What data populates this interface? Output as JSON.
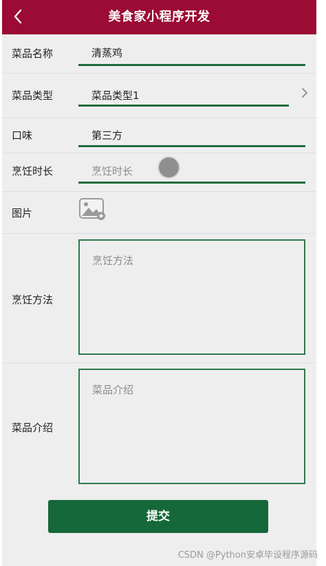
{
  "header": {
    "title": "美食家小程序开发",
    "back_icon": "chevron-left-icon"
  },
  "form": {
    "name": {
      "label": "菜品名称",
      "value": "清蒸鸡"
    },
    "type": {
      "label": "菜品类型",
      "value": "菜品类型1"
    },
    "taste": {
      "label": "口味",
      "value": "第三方"
    },
    "duration": {
      "label": "烹饪时长",
      "placeholder": "烹饪时长"
    },
    "image": {
      "label": "图片"
    },
    "method": {
      "label": "烹饪方法",
      "placeholder": "烹饪方法"
    },
    "intro": {
      "label": "菜品介绍",
      "placeholder": "菜品介绍"
    }
  },
  "submit_label": "提交",
  "watermark": "CSDN @Python安卓毕设程序源码",
  "colors": {
    "header": "#9b0b33",
    "accent": "#1f6b3d",
    "button": "#15683a"
  }
}
